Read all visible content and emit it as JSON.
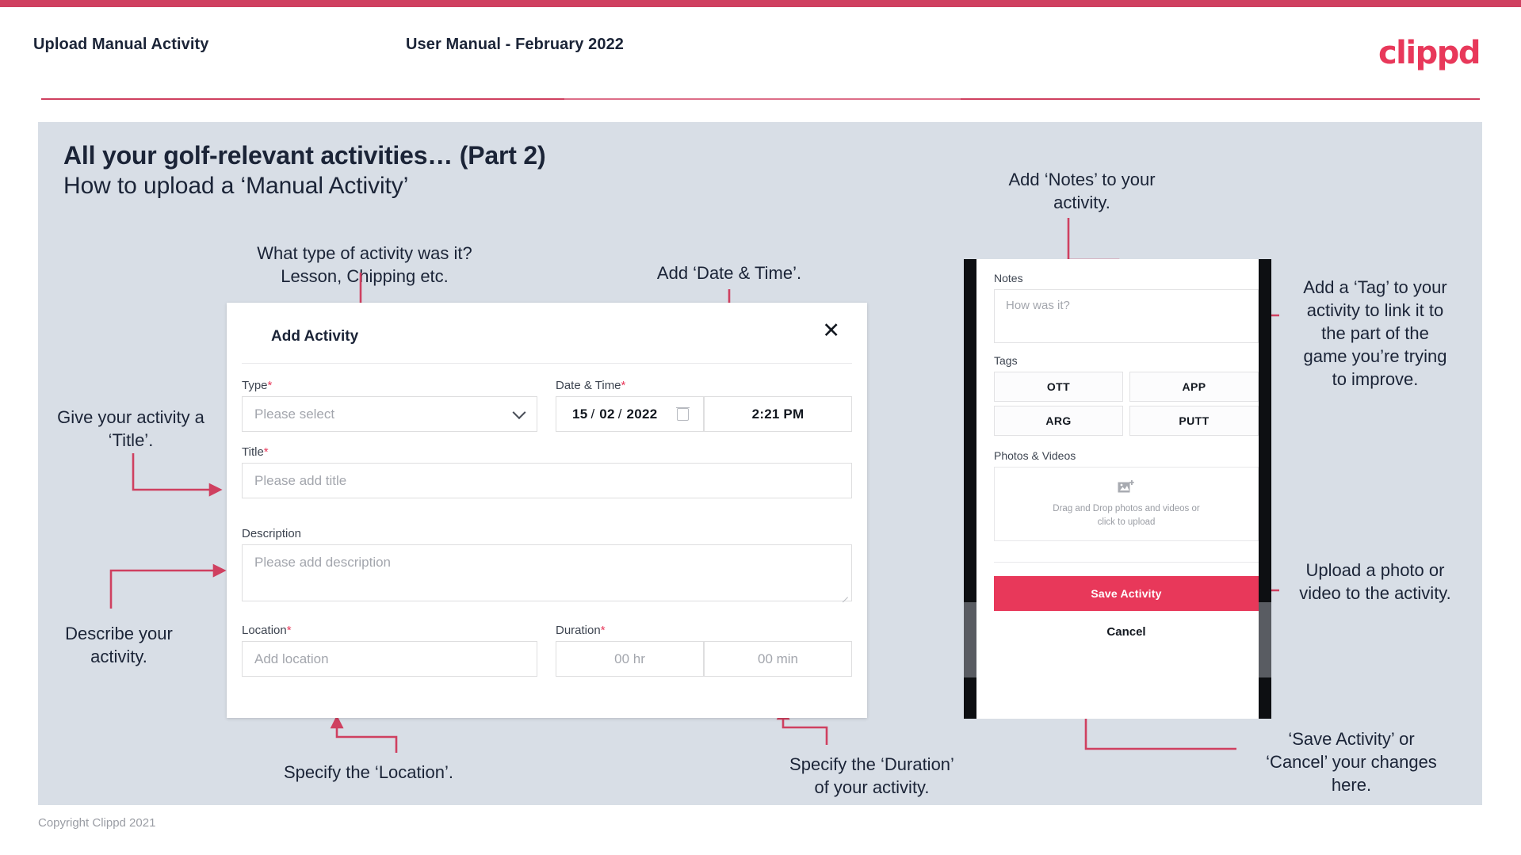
{
  "header": {
    "left_title": "Upload Manual Activity",
    "center_title": "User Manual - February 2022",
    "logo": "clippd"
  },
  "slide": {
    "title": "All your golf-relevant activities… (Part 2)",
    "subtitle": "How to upload a ‘Manual Activity’"
  },
  "annotations": {
    "type": "What type of activity was it?\nLesson, Chipping etc.",
    "datetime": "Add ‘Date & Time’.",
    "title": "Give your activity a\n‘Title’.",
    "description": "Describe your\nactivity.",
    "location": "Specify the ‘Location’.",
    "duration": "Specify the ‘Duration’\nof your activity.",
    "notes": "Add ‘Notes’ to your\nactivity.",
    "tags": "Add a ‘Tag’ to your\nactivity to link it to\nthe part of the\ngame you’re trying\nto improve.",
    "photos": "Upload a photo or\nvideo to the activity.",
    "save": "‘Save Activity’ or\n‘Cancel’ your changes\nhere."
  },
  "dialog": {
    "title": "Add Activity",
    "close_icon": "close-icon",
    "fields": {
      "type": {
        "label": "Type",
        "required": "*",
        "placeholder": "Please select",
        "chevron_icon": "chevron-down-icon"
      },
      "datetime": {
        "label": "Date & Time",
        "required": "*",
        "day": "15",
        "sep1": "/",
        "month": "02",
        "sep2": "/",
        "year": "2022",
        "calendar_icon": "calendar-icon",
        "time": "2:21 PM"
      },
      "title": {
        "label": "Title",
        "required": "*",
        "placeholder": "Please add title"
      },
      "description": {
        "label": "Description",
        "placeholder": "Please add description"
      },
      "location": {
        "label": "Location",
        "required": "*",
        "placeholder": "Add location"
      },
      "duration": {
        "label": "Duration",
        "required": "*",
        "hours_placeholder": "00 hr",
        "minutes_placeholder": "00 min"
      }
    }
  },
  "phone": {
    "notes": {
      "label": "Notes",
      "placeholder": "How was it?"
    },
    "tags": {
      "label": "Tags",
      "items": [
        "OTT",
        "APP",
        "ARG",
        "PUTT"
      ]
    },
    "photos": {
      "label": "Photos & Videos",
      "icon": "add-image-icon",
      "drop_line1": "Drag and Drop photos and videos or",
      "drop_line2": "click to upload"
    },
    "save_label": "Save Activity",
    "cancel_label": "Cancel"
  },
  "footer": "Copyright Clippd 2021",
  "colors": {
    "accent": "#e8385a",
    "accent_dark": "#cf4060",
    "slide_bg": "#d8dee6",
    "text": "#1b2437"
  }
}
